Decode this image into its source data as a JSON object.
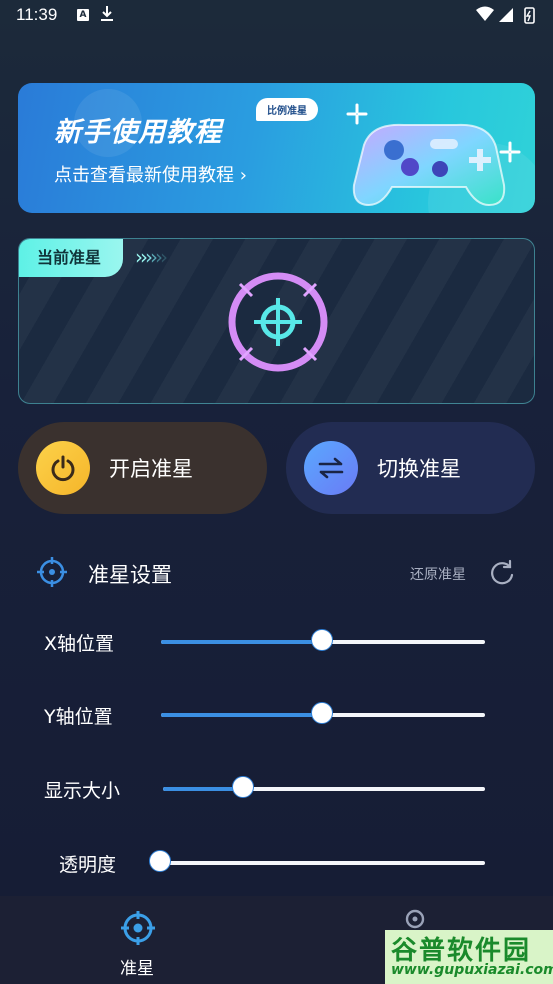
{
  "status_bar": {
    "time": "11:39",
    "notif_letter": "A"
  },
  "banner": {
    "title": "新手使用教程",
    "bubble": "比例准星",
    "subtitle": "点击查看最新使用教程 ›"
  },
  "preview": {
    "tag": "当前准星",
    "arrows": ">>>>>>"
  },
  "buttons": {
    "open_label": "开启准星",
    "switch_label": "切换准星"
  },
  "settings": {
    "title": "准星设置",
    "reset_label": "还原准星",
    "sliders": [
      {
        "label": "X轴位置",
        "value_pct": 50
      },
      {
        "label": "Y轴位置",
        "value_pct": 50
      },
      {
        "label": "显示大小",
        "value_pct": 25
      },
      {
        "label": "透明度",
        "value_pct": 0
      }
    ]
  },
  "bottom_nav": {
    "items": [
      {
        "label": "准星",
        "icon": "crosshair-icon",
        "active": true
      },
      {
        "label": "",
        "icon": "user-icon",
        "active": false
      }
    ]
  },
  "watermark": {
    "title": "谷普软件园",
    "url": "www.gupuxiazai.com"
  },
  "colors": {
    "accent": "#3b8fe3",
    "teal": "#5ef1e6",
    "crosshair_pink": "#d48cf5"
  }
}
